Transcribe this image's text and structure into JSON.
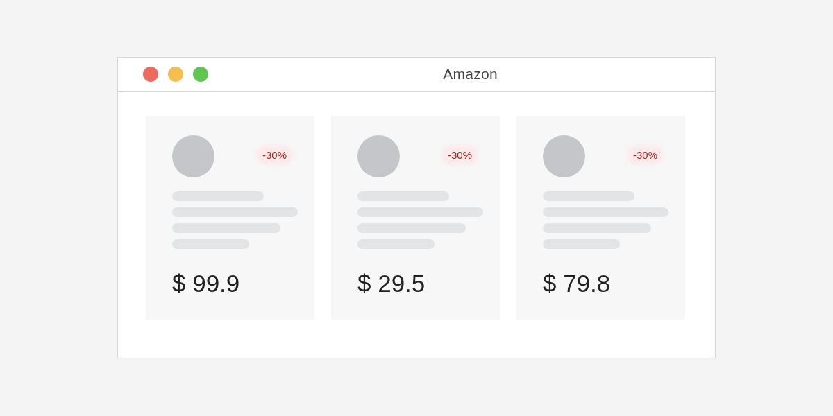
{
  "window": {
    "title": "Amazon"
  },
  "products": [
    {
      "discount": "-30%",
      "price": "$ 99.9"
    },
    {
      "discount": "-30%",
      "price": "$ 29.5"
    },
    {
      "discount": "-30%",
      "price": "$ 79.8"
    }
  ]
}
